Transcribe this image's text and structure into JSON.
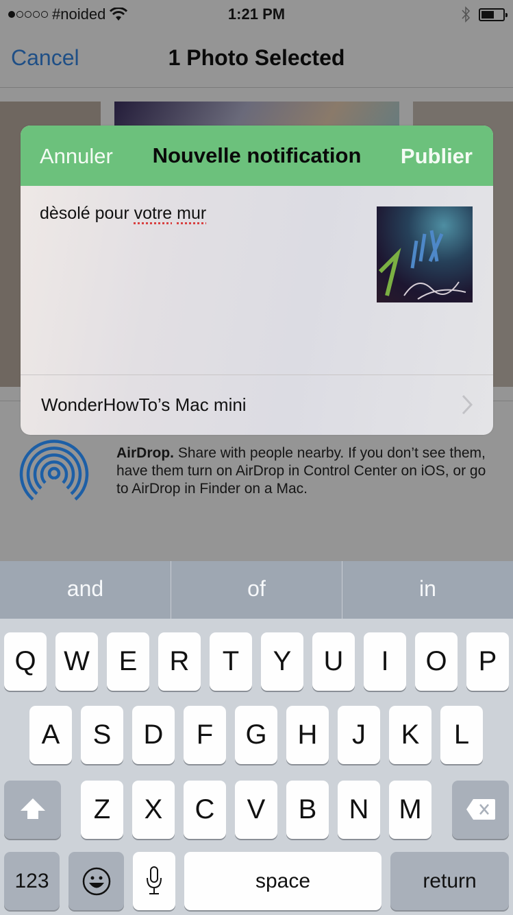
{
  "status_bar": {
    "signal_dots_filled": 1,
    "signal_dots_total": 5,
    "carrier": "#noided",
    "time": "1:21 PM",
    "battery_level": 0.5
  },
  "nav": {
    "cancel_label": "Cancel",
    "title": "1 Photo Selected"
  },
  "share_card": {
    "header_color": "#6cc17c",
    "cancel_label": "Annuler",
    "title": "Nouvelle notification",
    "publish_label": "Publier",
    "message_parts": [
      {
        "text": "dèsolé pour ",
        "misspelled": false
      },
      {
        "text": "votre",
        "misspelled": true
      },
      {
        "text": " ",
        "misspelled": false
      },
      {
        "text": "mur",
        "misspelled": true
      }
    ],
    "destination": "WonderHowTo’s Mac mini"
  },
  "airdrop": {
    "title": "AirDrop.",
    "description": " Share with people nearby. If you don’t see them, have them turn on AirDrop in Control Center on iOS, or go to AirDrop in Finder on a Mac.",
    "icon_color": "#1d5fa6"
  },
  "keyboard": {
    "suggestions": [
      "and",
      "of",
      "in"
    ],
    "row1": [
      "Q",
      "W",
      "E",
      "R",
      "T",
      "Y",
      "U",
      "I",
      "O",
      "P"
    ],
    "row2": [
      "A",
      "S",
      "D",
      "F",
      "G",
      "H",
      "J",
      "K",
      "L"
    ],
    "row3": [
      "Z",
      "X",
      "C",
      "V",
      "B",
      "N",
      "M"
    ],
    "numbers_label": "123",
    "space_label": "space",
    "return_label": "return"
  }
}
